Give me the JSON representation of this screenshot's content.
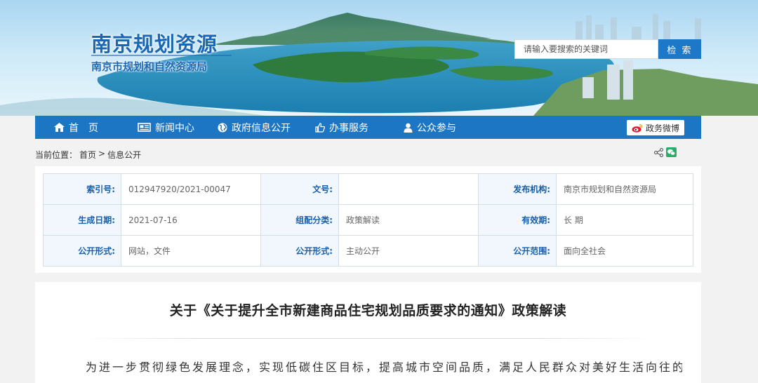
{
  "header": {
    "site_title": "南京规划资源",
    "site_subtitle": "南京市规划和自然资源局"
  },
  "search": {
    "placeholder": "请输入要搜索的关键词",
    "button_label": "检 索"
  },
  "nav": {
    "items": [
      {
        "label": "首　页",
        "icon": "home-icon"
      },
      {
        "label": "新闻中心",
        "icon": "newspaper-icon"
      },
      {
        "label": "政府信息公开",
        "icon": "globe-icon"
      },
      {
        "label": "办事服务",
        "icon": "thumbs-up-icon"
      },
      {
        "label": "公众参与",
        "icon": "user-icon"
      }
    ],
    "weibo_label": "政务微博"
  },
  "breadcrumb": {
    "prefix": "当前位置：",
    "home": "首页",
    "separator": ">",
    "current": "信息公开"
  },
  "share": {
    "icons": [
      "share-icon",
      "wechat-icon"
    ]
  },
  "meta": {
    "rows": [
      [
        {
          "key": "索引号:",
          "value": "012947920/2021-00047"
        },
        {
          "key": "文号:",
          "value": ""
        },
        {
          "key": "发布机构:",
          "value": "南京市规划和自然资源局"
        }
      ],
      [
        {
          "key": "生成日期:",
          "value": "2021-07-16"
        },
        {
          "key": "组配分类:",
          "value": "政策解读"
        },
        {
          "key": "有效期:",
          "value": "长 期"
        }
      ],
      [
        {
          "key": "公开形式:",
          "value": "网站，文件"
        },
        {
          "key": "公开形式:",
          "value": "主动公开"
        },
        {
          "key": "公开范围:",
          "value": "面向全社会"
        }
      ]
    ]
  },
  "article": {
    "title": "关于《关于提升全市新建商品住宅规划品质要求的通知》政策解读",
    "first_line": "为进一步贯彻绿色发展理念，实现低碳住区目标，提高城市空间品质，满足人民群众对美好生活向往的要"
  },
  "colors": {
    "nav_bg": "#1c76c4",
    "brand_blue": "#1a67b5",
    "table_key": "#1a5fa8"
  }
}
